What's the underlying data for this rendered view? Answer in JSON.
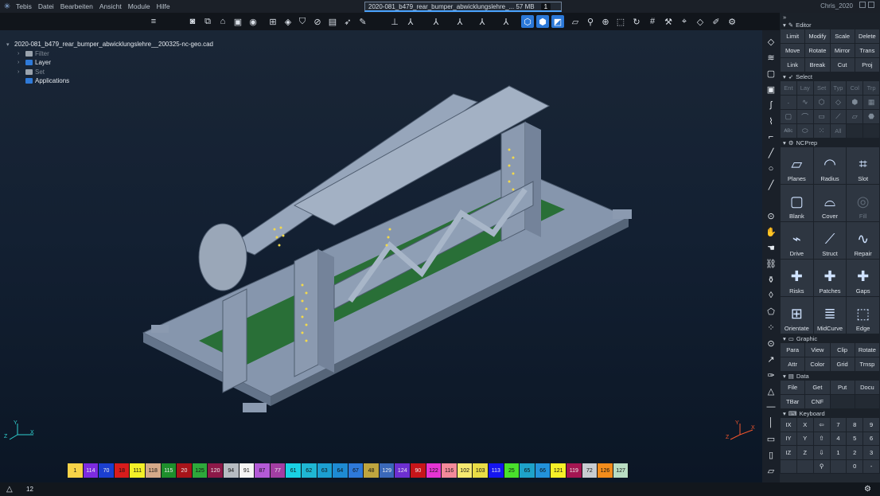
{
  "menubar": {
    "items": [
      "Tebis",
      "Datei",
      "Bearbeiten",
      "Ansicht",
      "Module",
      "Hilfe"
    ],
    "doc_tab": "2020-081_b479_rear_bumper_abwicklungslehre_...  57 MB",
    "doc_badge": "1",
    "user": "Chris_2020"
  },
  "toolbar": {
    "icons": [
      "layer-filter-icon",
      "camera-icon",
      "cube-set-icon",
      "house-icon",
      "cube-clip-icon",
      "eye-icon",
      "grid-icon",
      "layer-icon",
      "shield-icon",
      "slash-cube-icon",
      "save-icon",
      "pointer-icon",
      "paint-icon",
      "axis-xy-icon",
      "axis-iso1-icon",
      "axis-iso2-icon",
      "axis-iso3-icon",
      "axis-iso4-icon",
      "axis-iso5-icon",
      "view-shaded-icon",
      "view-wire-icon",
      "view-hidden-icon",
      "search-icon",
      "fit-icon",
      "window-icon",
      "rotate-icon",
      "hatch-icon",
      "wrench-icon",
      "vertex-icon",
      "mesh-icon",
      "pencil-icon"
    ],
    "active": [
      "view-shaded-icon",
      "view-wire-icon",
      "view-hidden-icon"
    ]
  },
  "tree": {
    "root": "2020-081_b479_rear_bumper_abwicklungslehre__200325-nc-geo.cad",
    "items": [
      {
        "label": "Filter",
        "dim": true
      },
      {
        "label": "Layer",
        "dim": false
      },
      {
        "label": "Set",
        "dim": true
      },
      {
        "label": "Applications",
        "dim": false
      }
    ]
  },
  "panel": {
    "editor": {
      "title": "Editor",
      "buttons": [
        "Limit",
        "Modify",
        "Scale",
        "Delete",
        "Move",
        "Rotate",
        "Mirror",
        "Trans",
        "Link",
        "Break",
        "Cut",
        "Proj"
      ]
    },
    "select": {
      "title": "Select",
      "buttons": [
        "Ent",
        "Lay",
        "Set",
        "Typ",
        "Col",
        "Trp"
      ],
      "extra": "All"
    },
    "ncprep": {
      "title": "NCPrep",
      "buttons": [
        {
          "label": "Planes",
          "icon": "planes-icon",
          "dim": false
        },
        {
          "label": "Radius",
          "icon": "radius-icon",
          "dim": false
        },
        {
          "label": "Slot",
          "icon": "slot-icon",
          "dim": false
        },
        {
          "label": "Blank",
          "icon": "blank-icon",
          "dim": false
        },
        {
          "label": "Cover",
          "icon": "cover-icon",
          "dim": false
        },
        {
          "label": "Fill",
          "icon": "fill-icon",
          "dim": true
        },
        {
          "label": "Drive",
          "icon": "drive-icon",
          "dim": false
        },
        {
          "label": "Struct",
          "icon": "struct-icon",
          "dim": false
        },
        {
          "label": "Repair",
          "icon": "repair-icon",
          "dim": false
        },
        {
          "label": "Risks",
          "icon": "risks-icon",
          "dim": false
        },
        {
          "label": "Patches",
          "icon": "patches-icon",
          "dim": false
        },
        {
          "label": "Gaps",
          "icon": "gaps-icon",
          "dim": false
        },
        {
          "label": "Orientate",
          "icon": "orientate-icon",
          "dim": false
        },
        {
          "label": "MidCurve",
          "icon": "midcurve-icon",
          "dim": false
        },
        {
          "label": "Edge",
          "icon": "edge-icon",
          "dim": false
        }
      ]
    },
    "graphic": {
      "title": "Graphic",
      "buttons": [
        "Para",
        "View",
        "Clip",
        "Rotate",
        "Attr",
        "Color",
        "Grid",
        "Trnsp"
      ]
    },
    "data": {
      "title": "Data",
      "buttons": [
        "File",
        "Get",
        "Put",
        "Docu",
        "TBar",
        "CNF"
      ]
    },
    "keyboard": {
      "title": "Keyboard",
      "keys": [
        "IX",
        "X",
        "⇦",
        "7",
        "8",
        "9",
        "IY",
        "Y",
        "⇧",
        "4",
        "5",
        "6",
        "IZ",
        "Z",
        "⇩",
        "1",
        "2",
        "3",
        "",
        "",
        "⚲",
        "",
        "0",
        "-"
      ]
    }
  },
  "palette": [
    {
      "num": "1",
      "color": "#f7d348"
    },
    {
      "num": "114",
      "color": "#7d2be0"
    },
    {
      "num": "70",
      "color": "#1b3fcf"
    },
    {
      "num": "18",
      "color": "#d81c1c"
    },
    {
      "num": "111",
      "color": "#f3ef28"
    },
    {
      "num": "118",
      "color": "#d4a989"
    },
    {
      "num": "115",
      "color": "#1e8f2c"
    },
    {
      "num": "20",
      "color": "#a8141a"
    },
    {
      "num": "125",
      "color": "#2ea83b"
    },
    {
      "num": "120",
      "color": "#8c1948"
    },
    {
      "num": "94",
      "color": "#b7bcc2"
    },
    {
      "num": "91",
      "color": "#f4f4f4"
    },
    {
      "num": "87",
      "color": "#b35ad7"
    },
    {
      "num": "77",
      "color": "#a33ea3"
    },
    {
      "num": "61",
      "color": "#1ad1e4"
    },
    {
      "num": "62",
      "color": "#1fb7d3"
    },
    {
      "num": "63",
      "color": "#1c9fd0"
    },
    {
      "num": "64",
      "color": "#1e8bd3"
    },
    {
      "num": "67",
      "color": "#2e79d9"
    },
    {
      "num": "48",
      "color": "#bfa53f"
    },
    {
      "num": "129",
      "color": "#3a68b8"
    },
    {
      "num": "124",
      "color": "#6d2fd0"
    },
    {
      "num": "90",
      "color": "#c7151a"
    },
    {
      "num": "122",
      "color": "#e534d3"
    },
    {
      "num": "116",
      "color": "#f38a9a"
    },
    {
      "num": "102",
      "color": "#f5e870"
    },
    {
      "num": "103",
      "color": "#e9dc46"
    },
    {
      "num": "113",
      "color": "#1515ef"
    },
    {
      "num": "25",
      "color": "#49e02c"
    },
    {
      "num": "65",
      "color": "#1ea2c9"
    },
    {
      "num": "66",
      "color": "#2392da"
    },
    {
      "num": "121",
      "color": "#f7f028"
    },
    {
      "num": "119",
      "color": "#a41652"
    },
    {
      "num": "72",
      "color": "#c8ccd1"
    },
    {
      "num": "126",
      "color": "#f28c1c"
    },
    {
      "num": "127",
      "color": "#b9ddc3"
    }
  ],
  "status": {
    "count": "12"
  },
  "axes": {
    "left": {
      "x": "X",
      "y": "Y",
      "z": "Z"
    },
    "right": {
      "x": "X",
      "y": "Y",
      "z": "Z"
    }
  }
}
